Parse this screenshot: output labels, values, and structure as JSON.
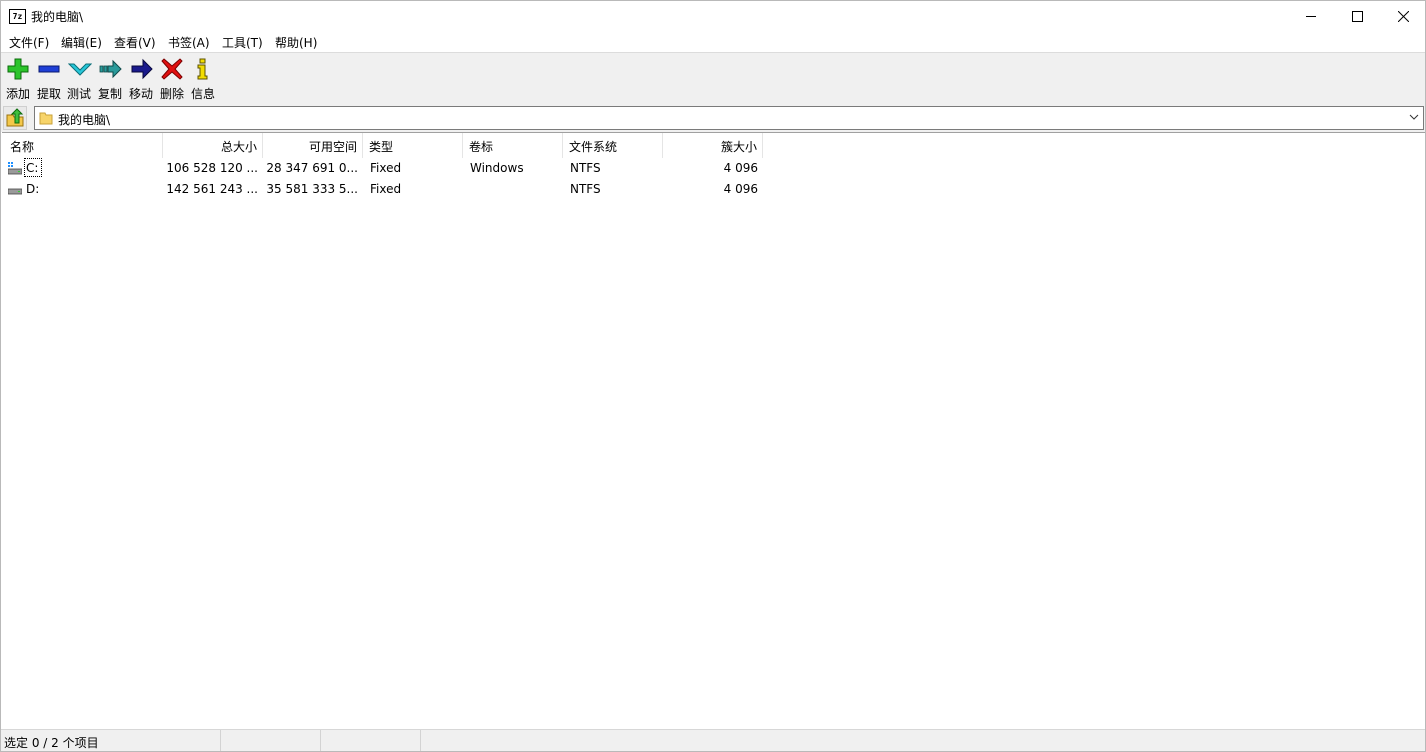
{
  "window": {
    "title": "我的电脑\\",
    "app_logo": "7z",
    "controls": [
      "minimize-icon",
      "maximize-icon",
      "close-icon"
    ]
  },
  "menu": [
    {
      "label": "文件(F)"
    },
    {
      "label": "编辑(E)"
    },
    {
      "label": "查看(V)"
    },
    {
      "label": "书签(A)"
    },
    {
      "label": "工具(T)"
    },
    {
      "label": "帮助(H)"
    }
  ],
  "toolbar": [
    {
      "label": "添加",
      "icon": "add-icon",
      "color": "#2bb52b"
    },
    {
      "label": "提取",
      "icon": "extract-icon",
      "color": "#1e3fd6"
    },
    {
      "label": "测试",
      "icon": "test-icon",
      "color": "#1fb3c7"
    },
    {
      "label": "复制",
      "icon": "copy-icon",
      "color": "#2a8a8a"
    },
    {
      "label": "移动",
      "icon": "move-icon",
      "color": "#1a1a8c"
    },
    {
      "label": "删除",
      "icon": "delete-icon",
      "color": "#e01010"
    },
    {
      "label": "信息",
      "icon": "info-icon",
      "color": "#e8d000"
    }
  ],
  "address": {
    "path": "我的电脑\\",
    "up_icon": "folder-up-icon",
    "folder_icon": "folder-icon"
  },
  "columns": [
    {
      "label": "名称"
    },
    {
      "label": "总大小"
    },
    {
      "label": "可用空间"
    },
    {
      "label": "类型"
    },
    {
      "label": "卷标"
    },
    {
      "label": "文件系统"
    },
    {
      "label": "簇大小"
    }
  ],
  "rows": [
    {
      "name": "C:",
      "total": "106 528 120 ...",
      "free": "28 347 691 0...",
      "type": "Fixed",
      "label": "Windows",
      "fs": "NTFS",
      "cluster": "4 096",
      "icon": "system-drive-icon"
    },
    {
      "name": "D:",
      "total": "142 561 243 ...",
      "free": "35 581 333 5...",
      "type": "Fixed",
      "label": "",
      "fs": "NTFS",
      "cluster": "4 096",
      "icon": "drive-icon"
    }
  ],
  "status": {
    "selection": "选定 0 / 2 个项目"
  }
}
